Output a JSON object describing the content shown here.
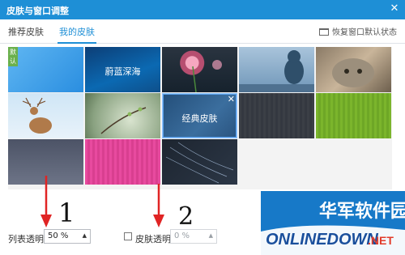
{
  "window": {
    "title": "皮肤与窗口调整",
    "close_label": "✕"
  },
  "tabs": [
    {
      "label": "推荐皮肤"
    },
    {
      "label": "我的皮肤"
    }
  ],
  "restore_label": "恢复窗口默认状态",
  "skins": [
    {
      "label": "",
      "badge": "默认"
    },
    {
      "label": "蔚蓝深海"
    },
    {
      "label": ""
    },
    {
      "label": ""
    },
    {
      "label": ""
    },
    {
      "label": ""
    },
    {
      "label": ""
    },
    {
      "label": "经典皮肤",
      "close": "✕"
    },
    {
      "label": ""
    },
    {
      "label": ""
    },
    {
      "label": ""
    },
    {
      "label": ""
    },
    {
      "label": ""
    }
  ],
  "list_opacity": {
    "label": "列表透明",
    "value": "50 %",
    "arrow": "▲"
  },
  "skin_opacity": {
    "label": "皮肤透明",
    "value": "0 %",
    "arrow": "▲"
  },
  "annotations": [
    "1",
    "2"
  ],
  "watermark": {
    "cn": "华军软件园",
    "en": "ONLINEDOWN",
    "suffix": ".NET"
  }
}
